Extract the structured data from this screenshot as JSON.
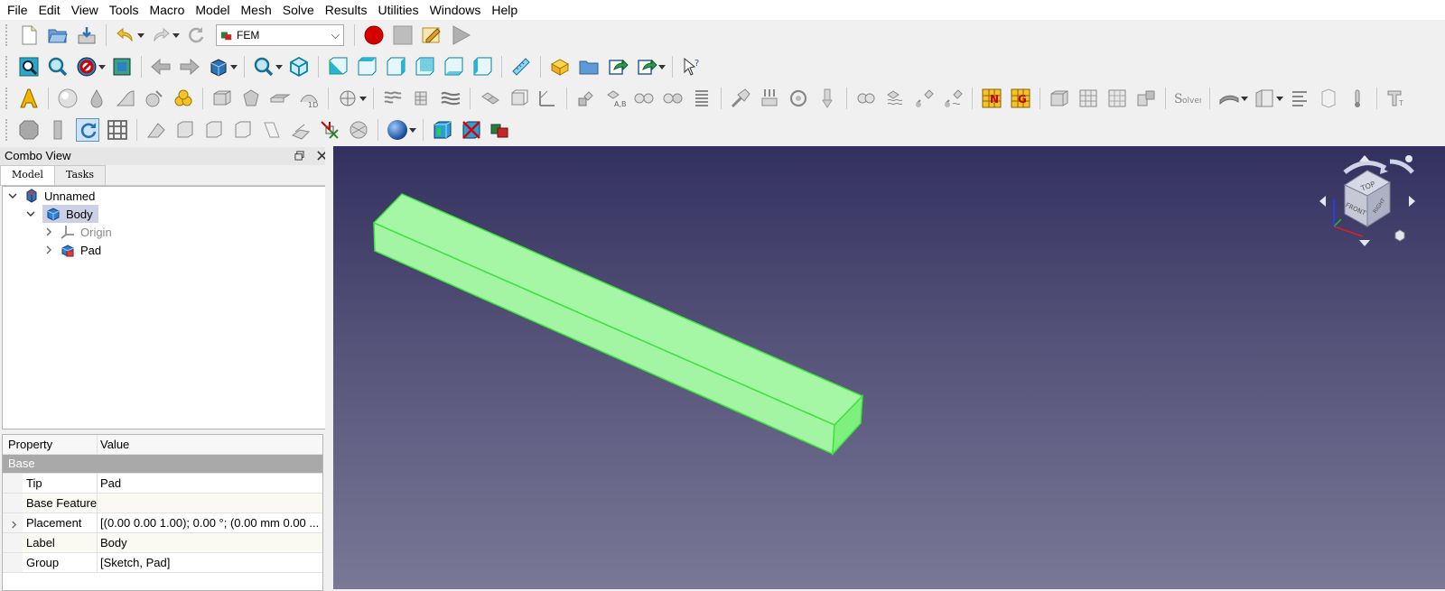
{
  "menu": [
    "File",
    "Edit",
    "View",
    "Tools",
    "Macro",
    "Model",
    "Mesh",
    "Solve",
    "Results",
    "Utilities",
    "Windows",
    "Help"
  ],
  "workbench": {
    "selected": "FEM"
  },
  "combo_view": {
    "title": "Combo View",
    "tabs": [
      "Model",
      "Tasks"
    ],
    "tree": [
      {
        "label": "Unnamed"
      },
      {
        "label": "Body"
      },
      {
        "label": "Origin"
      },
      {
        "label": "Pad"
      }
    ]
  },
  "properties": {
    "headers": [
      "Property",
      "Value"
    ],
    "group": "Base",
    "rows": [
      {
        "name": "Tip",
        "value": "Pad"
      },
      {
        "name": "Base Feature",
        "value": ""
      },
      {
        "name": "Placement",
        "value": "[(0.00 0.00 1.00); 0.00 °; (0.00 mm  0.00 ..."
      },
      {
        "name": "Label",
        "value": "Body"
      },
      {
        "name": "Group",
        "value": "[Sketch, Pad]"
      }
    ]
  },
  "navcube": {
    "top": "TOP",
    "front": "FRONT",
    "right": "RIGHT"
  },
  "colors": {
    "viewport_top": "#33305f",
    "viewport_bottom": "#7a7896",
    "solid": "#a5f7a5",
    "solid_edge": "#3ee33e",
    "selection": "#ccd0e6"
  }
}
